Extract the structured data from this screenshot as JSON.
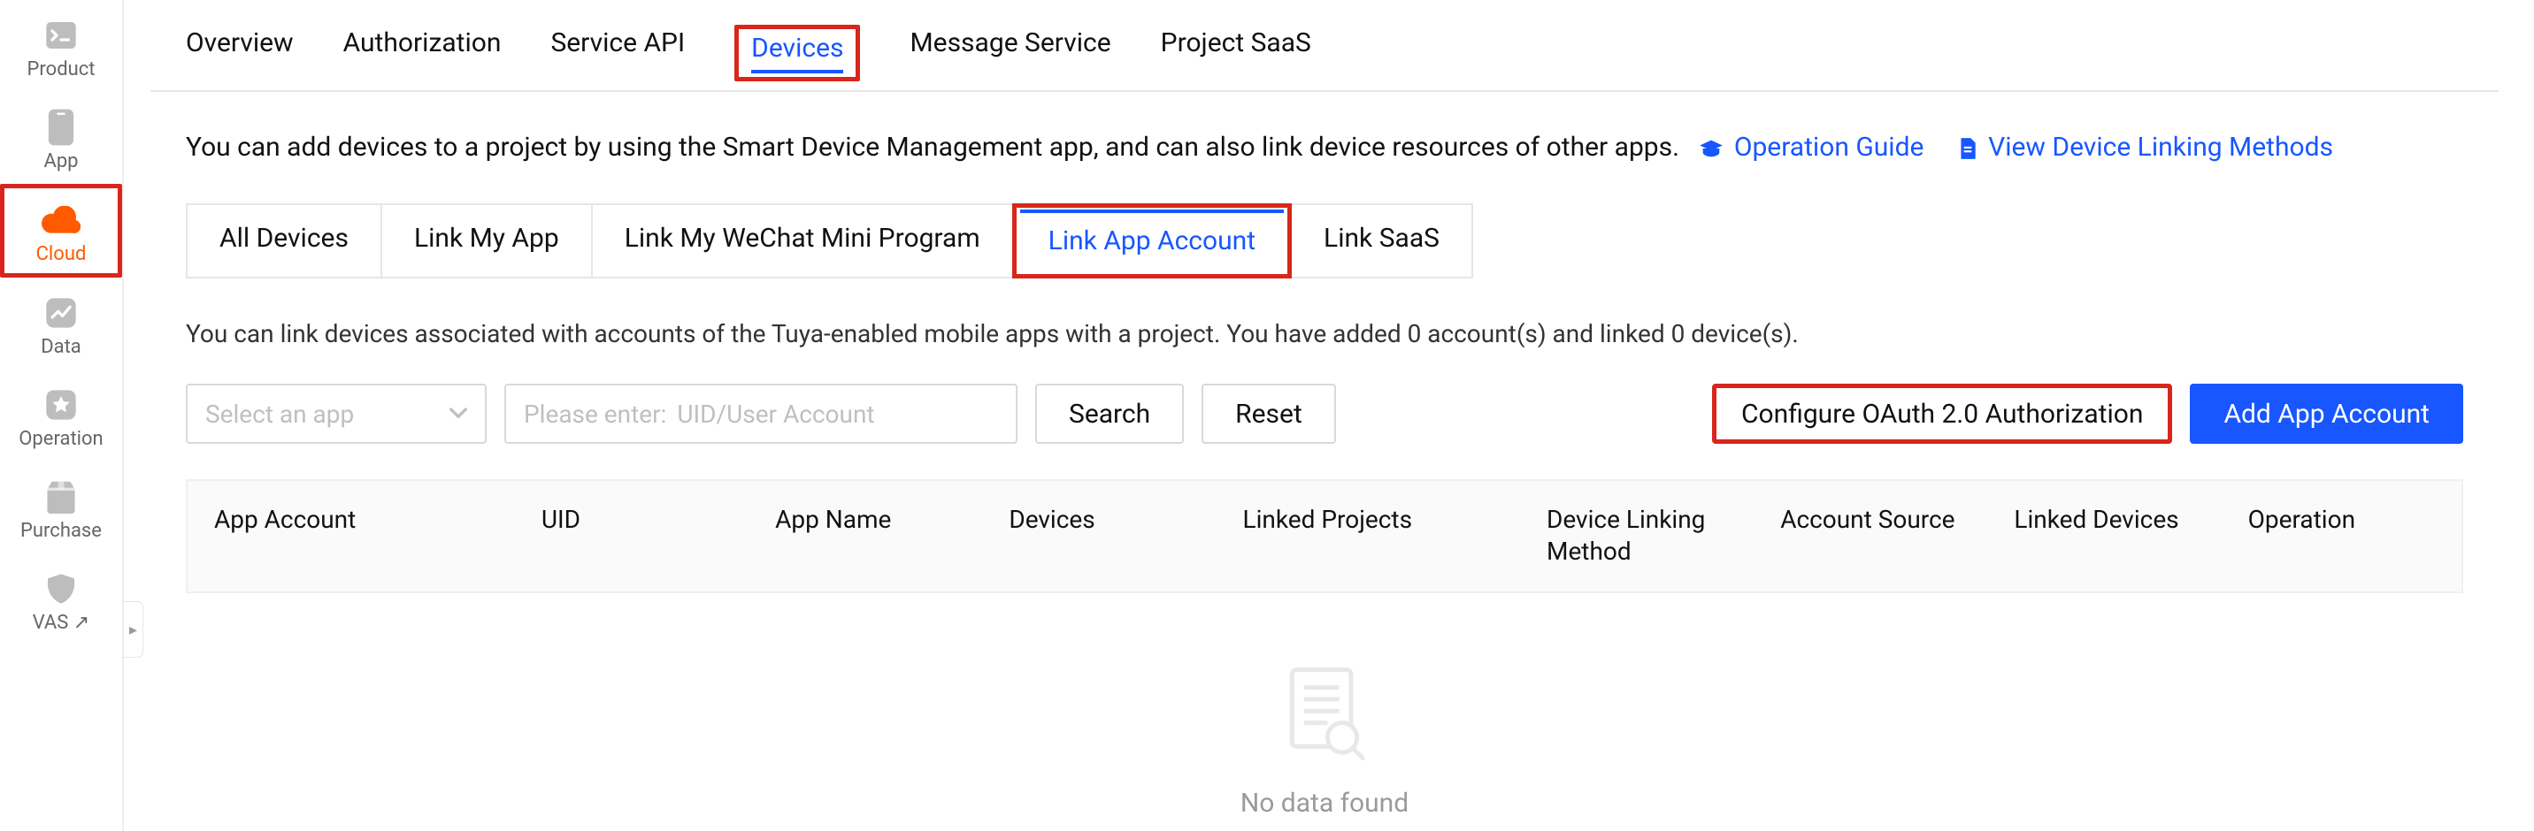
{
  "sidebar": {
    "items": [
      {
        "id": "product",
        "label": "Product"
      },
      {
        "id": "app",
        "label": "App"
      },
      {
        "id": "cloud",
        "label": "Cloud",
        "active": true
      },
      {
        "id": "data",
        "label": "Data"
      },
      {
        "id": "operation",
        "label": "Operation"
      },
      {
        "id": "purchase",
        "label": "Purchase"
      },
      {
        "id": "vas",
        "label": "VAS ↗"
      }
    ]
  },
  "nav": {
    "tabs": [
      {
        "label": "Overview"
      },
      {
        "label": "Authorization"
      },
      {
        "label": "Service API"
      },
      {
        "label": "Devices",
        "active": true
      },
      {
        "label": "Message Service"
      },
      {
        "label": "Project SaaS"
      }
    ]
  },
  "description": {
    "text": "You can add devices to a project by using the Smart Device Management app, and can also link device resources of other apps.",
    "link1": "Operation Guide",
    "link2": "View Device Linking Methods"
  },
  "sub_tabs": [
    {
      "label": "All Devices"
    },
    {
      "label": "Link My App"
    },
    {
      "label": "Link My WeChat Mini Program"
    },
    {
      "label": "Link App Account",
      "active": true
    },
    {
      "label": "Link SaaS"
    }
  ],
  "status_text": "You can link devices associated with accounts of the Tuya-enabled mobile apps with a project. You have added 0 account(s) and linked 0 device(s).",
  "filters": {
    "select_placeholder": "Select an app",
    "input_prefix": "Please enter:",
    "input_placeholder": "UID/User Account",
    "search_label": "Search",
    "reset_label": "Reset",
    "oauth_label": "Configure OAuth 2.0 Authorization",
    "add_label": "Add App Account"
  },
  "table": {
    "columns": [
      "App Account",
      "UID",
      "App Name",
      "Devices",
      "Linked Projects",
      "Device Linking Method",
      "Account Source",
      "Linked Devices",
      "Operation"
    ],
    "empty_text": "No data found"
  }
}
